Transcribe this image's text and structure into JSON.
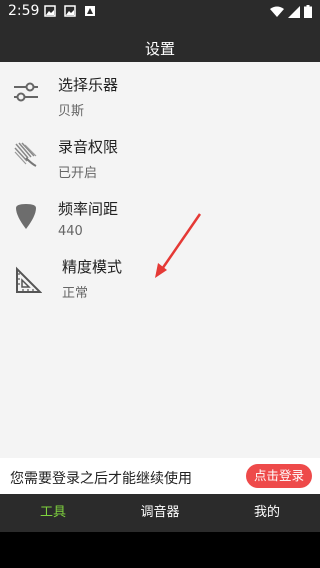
{
  "status_bar": {
    "time": "2:59",
    "left_icons": [
      "image-icon",
      "image-icon",
      "notification-icon"
    ],
    "right_icons": [
      "wifi-icon",
      "signal-icon",
      "battery-icon"
    ]
  },
  "header": {
    "title": "设置"
  },
  "settings": {
    "items": [
      {
        "label": "选择乐器",
        "value": "贝斯",
        "icon": "sliders-icon"
      },
      {
        "label": "录音权限",
        "value": "已开启",
        "icon": "microphone-permission-icon"
      },
      {
        "label": "频率间距",
        "value": "440",
        "icon": "guitar-pick-icon"
      },
      {
        "label": "精度模式",
        "value": "正常",
        "icon": "set-square-icon"
      }
    ]
  },
  "annotation": {
    "color": "#e53935"
  },
  "banner": {
    "message": "您需要登录之后才能继续使用",
    "login_label": "点击登录",
    "accent": "#ee4a4a"
  },
  "tabs": [
    {
      "label": "工具",
      "active": true
    },
    {
      "label": "调音器",
      "active": false
    },
    {
      "label": "我的",
      "active": false
    }
  ],
  "colors": {
    "bar": "#2b2b2b",
    "active_tab": "#7fd33e"
  }
}
